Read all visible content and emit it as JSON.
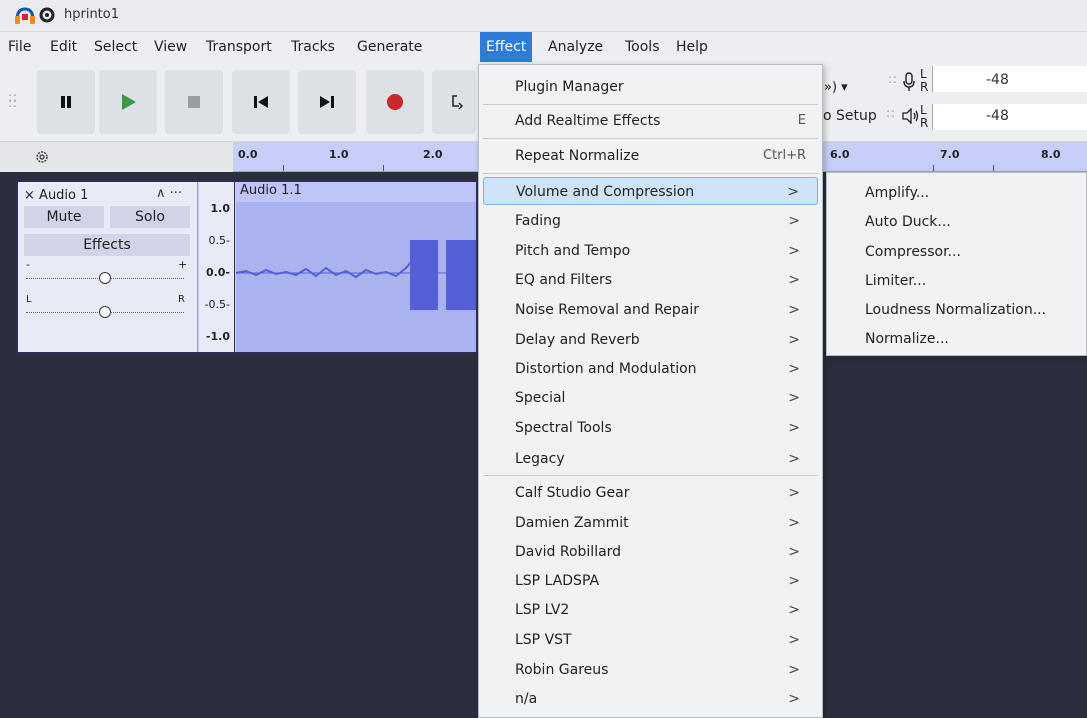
{
  "window": {
    "title": "hprinto1"
  },
  "menubar": [
    "File",
    "Edit",
    "Select",
    "View",
    "Transport",
    "Tracks",
    "Generate",
    "Effect",
    "Analyze",
    "Tools",
    "Help"
  ],
  "toolbar": {
    "partial_device_text": "») ▾",
    "audio_setup_partial": "o Setup",
    "meter_rec_value": "-48",
    "meter_play_value": "-48",
    "meter_L": "L",
    "meter_R": "R"
  },
  "ruler": {
    "ticks": [
      "0.0",
      "1.0",
      "2.0",
      "6.0",
      "7.0",
      "8.0"
    ]
  },
  "track": {
    "name": "Audio 1",
    "collapse": "∧ ···",
    "close": "×",
    "mute": "Mute",
    "solo": "Solo",
    "effects": "Effects",
    "gain_minus": "-",
    "gain_plus": "+",
    "pan_left": "L",
    "pan_right": "R",
    "gain_level": 0.5,
    "pan_level": 0.5,
    "scale": [
      "1.0",
      "0.5-",
      "0.0-",
      "-0.5-",
      "-1.0"
    ],
    "clip_name": "Audio 1.1"
  },
  "effect_menu": {
    "items": [
      {
        "label": "Plugin Manager",
        "shortcut": ""
      },
      {
        "label": "Add Realtime Effects",
        "shortcut": "E"
      },
      {
        "label": "Repeat Normalize",
        "shortcut": "Ctrl+R"
      },
      {
        "label": "Volume and Compression",
        "submenu": true
      },
      {
        "label": "Fading",
        "submenu": true
      },
      {
        "label": "Pitch and Tempo",
        "submenu": true
      },
      {
        "label": "EQ and Filters",
        "submenu": true
      },
      {
        "label": "Noise Removal and Repair",
        "submenu": true
      },
      {
        "label": "Delay and Reverb",
        "submenu": true
      },
      {
        "label": "Distortion and Modulation",
        "submenu": true
      },
      {
        "label": "Special",
        "submenu": true
      },
      {
        "label": "Spectral Tools",
        "submenu": true
      },
      {
        "label": "Legacy",
        "submenu": true
      },
      {
        "label": "Calf Studio Gear",
        "submenu": true
      },
      {
        "label": "Damien Zammit",
        "submenu": true
      },
      {
        "label": "David Robillard",
        "submenu": true
      },
      {
        "label": "LSP LADSPA",
        "submenu": true
      },
      {
        "label": "LSP LV2",
        "submenu": true
      },
      {
        "label": "LSP VST",
        "submenu": true
      },
      {
        "label": "Robin Gareus",
        "submenu": true
      },
      {
        "label": "n/a",
        "submenu": true
      }
    ],
    "arrow": ">"
  },
  "submenu": {
    "items": [
      "Amplify...",
      "Auto Duck...",
      "Compressor...",
      "Limiter...",
      "Loudness Normalization...",
      "Normalize..."
    ]
  },
  "colors": {
    "accent": "#2f7cd6",
    "waveform": "#5560d6",
    "highlight": "#cfe3f7",
    "play": "#3a9a4a",
    "record": "#c8282e"
  }
}
